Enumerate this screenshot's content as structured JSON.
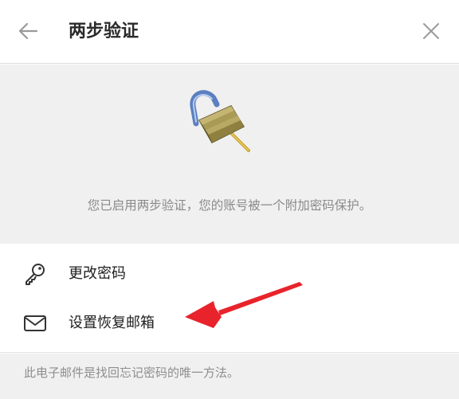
{
  "header": {
    "title": "两步验证",
    "back_icon": "arrow-left-icon",
    "close_icon": "close-icon"
  },
  "hero": {
    "icon": "unlocked-padlock-icon",
    "message": "您已启用两步验证，您的账号被一个附加密码保护。"
  },
  "menu": {
    "items": [
      {
        "label": "更改密码",
        "icon": "key-icon"
      },
      {
        "label": "设置恢复邮箱",
        "icon": "mail-icon"
      }
    ]
  },
  "footer": {
    "note": "此电子邮件是找回忘记密码的唯一方法。"
  },
  "colors": {
    "annotation_arrow": "#e8232b",
    "hero_bg": "#f0f0f0"
  }
}
